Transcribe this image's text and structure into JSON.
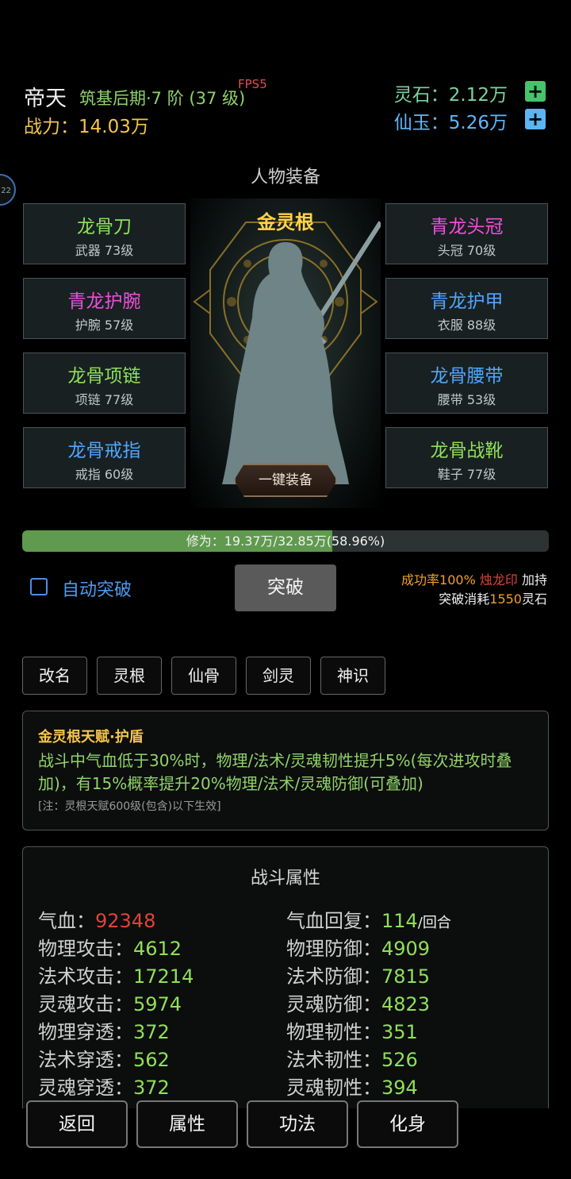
{
  "header": {
    "name": "帝天",
    "realm": "筑基后期·7 阶 (37 级)",
    "fps": "FPS5",
    "power_label": "战力：",
    "power_value": "14.03万",
    "spirit_stone_label": "灵石：",
    "spirit_stone_value": "2.12万",
    "jade_label": "仙玉：",
    "jade_value": "5.26万",
    "plus": "+",
    "side_badge": "22"
  },
  "equipment": {
    "title": "人物装备",
    "root": "金灵根",
    "one_click": "一键装备",
    "left": [
      {
        "name": "龙骨刀",
        "slot": "武器 73级"
      },
      {
        "name": "青龙护腕",
        "slot": "护腕 57级"
      },
      {
        "name": "龙骨项链",
        "slot": "项链 77级"
      },
      {
        "name": "龙骨戒指",
        "slot": "戒指 60级"
      }
    ],
    "right": [
      {
        "name": "青龙头冠",
        "slot": "头冠 70级"
      },
      {
        "name": "青龙护甲",
        "slot": "衣服 88级"
      },
      {
        "name": "龙骨腰带",
        "slot": "腰带 53级"
      },
      {
        "name": "龙骨战靴",
        "slot": "鞋子 77级"
      }
    ]
  },
  "cultivation": {
    "text": "修为：19.37万/32.85万(58.96%)",
    "fraction": 0.5896
  },
  "breakthrough": {
    "auto_label": "自动突破",
    "button": "突破",
    "rate_prefix": "成功率100%",
    "rate_item": "烛龙印",
    "rate_suffix": "加持",
    "cost_prefix": "突破消耗",
    "cost_value": "1550",
    "cost_unit": "灵石"
  },
  "tabs": [
    "改名",
    "灵根",
    "仙骨",
    "剑灵",
    "神识"
  ],
  "talent": {
    "title": "金灵根天赋·护盾",
    "desc": "战斗中气血低于30%时，物理/法术/灵魂韧性提升5%(每次进攻时叠加)，有15%概率提升20%物理/法术/灵魂防御(可叠加)",
    "note": "[注：灵根天赋600级(包含)以下生效]"
  },
  "stats": {
    "title": "战斗属性",
    "left": [
      {
        "label": "气血：",
        "value": "92348"
      },
      {
        "label": "物理攻击：",
        "value": "4612"
      },
      {
        "label": "法术攻击：",
        "value": "17214"
      },
      {
        "label": "灵魂攻击：",
        "value": "5974"
      },
      {
        "label": "物理穿透：",
        "value": "372"
      },
      {
        "label": "法术穿透：",
        "value": "562"
      },
      {
        "label": "灵魂穿透：",
        "value": "372"
      }
    ],
    "right": [
      {
        "label": "气血回复：",
        "value": "114",
        "unit": "/回合"
      },
      {
        "label": "物理防御：",
        "value": "4909"
      },
      {
        "label": "法术防御：",
        "value": "7815"
      },
      {
        "label": "灵魂防御：",
        "value": "4823"
      },
      {
        "label": "物理韧性：",
        "value": "351"
      },
      {
        "label": "法术韧性：",
        "value": "526"
      },
      {
        "label": "灵魂韧性：",
        "value": "394"
      }
    ]
  },
  "bottom_nav": [
    "返回",
    "属性",
    "功法",
    "化身"
  ],
  "colors": {
    "power": "#f3c64a",
    "green_text": "#8fe05a",
    "blue_text": "#4fa6ff",
    "pink_text": "#f04fd8",
    "red_value": "#e0433a",
    "progress_fill": "#5f9a4e"
  }
}
